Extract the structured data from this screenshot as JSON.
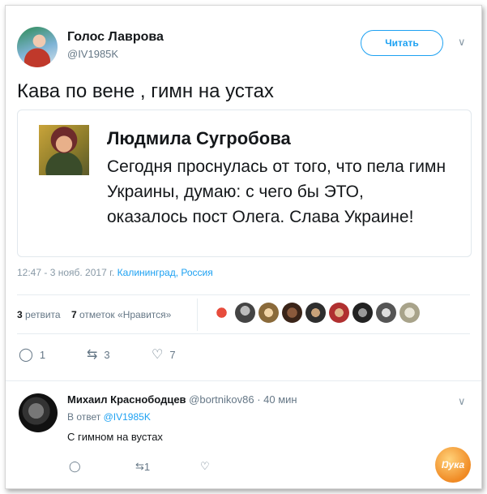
{
  "tweet": {
    "author_name": "Голос Лаврова",
    "author_handle": "@IV1985K",
    "follow_label": "Читать",
    "text": "Кава по вене , гимн на устах",
    "quote": {
      "author_name": "Людмила Сугробова",
      "text": "Сегодня проснулась от того, что пела гимн Украины, думаю: с чего бы ЭТО, оказалось пост Олега. Слава Украине!"
    },
    "timestamp": "12:47 - 3 нояб. 2017 г.",
    "location": "Калининград, Россия",
    "retweets_count": "3",
    "retweets_label": "ретвита",
    "likes_count": "7",
    "likes_label": "отметок «Нравится»",
    "actions": {
      "reply": "1",
      "retweet": "3",
      "like": "7"
    }
  },
  "reply": {
    "author_name": "Михаил Краснободцев",
    "author_handle": "@bortnikov86",
    "time": "· 40 мин",
    "reply_to_label": "В ответ",
    "reply_to_handle": "@IV1985K",
    "text": "С гимном на вустах",
    "actions": {
      "retweet": "1"
    }
  },
  "colors": {
    "accent": "#1da1f2",
    "muted": "#657786"
  },
  "icons": [
    "chevron-down-icon",
    "reply-icon",
    "retweet-icon",
    "heart-icon"
  ]
}
